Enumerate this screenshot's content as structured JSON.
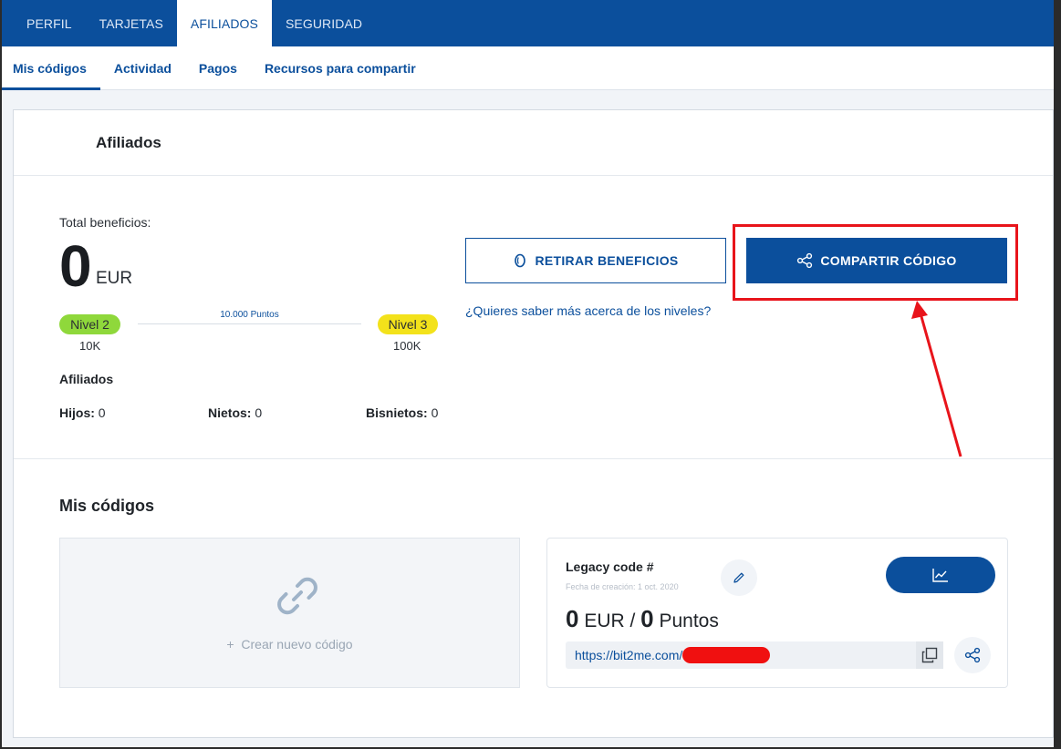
{
  "top_tabs": [
    {
      "label": "PERFIL",
      "active": false
    },
    {
      "label": "TARJETAS",
      "active": false
    },
    {
      "label": "AFILIADOS",
      "active": true
    },
    {
      "label": "SEGURIDAD",
      "active": false
    }
  ],
  "sub_tabs": [
    {
      "label": "Mis códigos",
      "active": true
    },
    {
      "label": "Actividad",
      "active": false
    },
    {
      "label": "Pagos",
      "active": false
    },
    {
      "label": "Recursos para compartir",
      "active": false
    }
  ],
  "affiliates_card": {
    "title": "Afiliados",
    "total_label": "Total beneficios:",
    "total_value": "0",
    "total_unit": "EUR",
    "levels": {
      "current_label": "Nivel 2",
      "current_color": "#8fd83b",
      "current_min": "10K",
      "next_label": "Nivel 3",
      "next_color": "#f3e21b",
      "next_min": "100K",
      "points_text": "10.000 Puntos"
    },
    "affiliates_title": "Afiliados",
    "stats": {
      "hijos_label": "Hijos:",
      "hijos_value": "0",
      "nietos_label": "Nietos:",
      "nietos_value": "0",
      "bisnietos_label": "Bisnietos:",
      "bisnietos_value": "0"
    },
    "withdraw_button": "RETIRAR BENEFICIOS",
    "share_button": "COMPARTIR CÓDIGO",
    "levels_link": "¿Quieres saber más acerca de los niveles?"
  },
  "codes_section": {
    "title": "Mis códigos",
    "create_label": "Crear nuevo código",
    "code": {
      "name": "Legacy code #",
      "date": "Fecha de creación: 1 oct. 2020",
      "eur_value": "0",
      "eur_unit": "EUR /",
      "points_value": "0",
      "points_unit": "Puntos",
      "url": "https://bit2me.com/"
    }
  },
  "colors": {
    "brand": "#0b4f9c",
    "annotation": "#e8141b"
  },
  "icons": [
    "coin-icon",
    "share-icon",
    "link-icon",
    "plus-icon",
    "pencil-icon",
    "chart-icon",
    "copy-icon"
  ]
}
